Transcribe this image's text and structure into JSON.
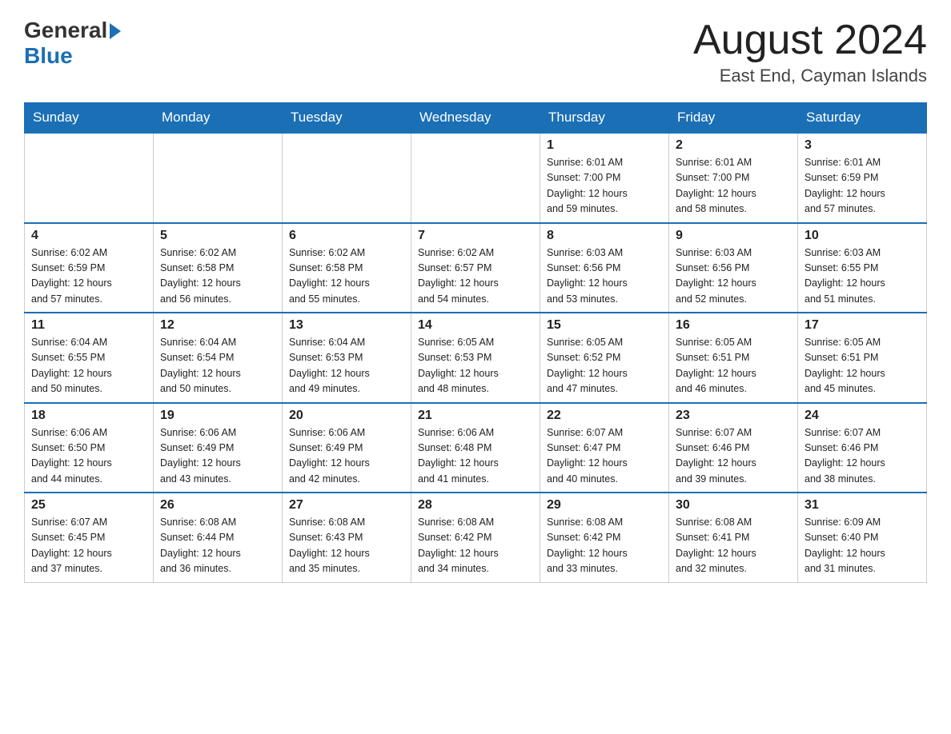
{
  "header": {
    "logo_general": "General",
    "logo_blue": "Blue",
    "month_title": "August 2024",
    "location": "East End, Cayman Islands"
  },
  "weekdays": [
    "Sunday",
    "Monday",
    "Tuesday",
    "Wednesday",
    "Thursday",
    "Friday",
    "Saturday"
  ],
  "weeks": [
    [
      {
        "day": "",
        "info": ""
      },
      {
        "day": "",
        "info": ""
      },
      {
        "day": "",
        "info": ""
      },
      {
        "day": "",
        "info": ""
      },
      {
        "day": "1",
        "info": "Sunrise: 6:01 AM\nSunset: 7:00 PM\nDaylight: 12 hours\nand 59 minutes."
      },
      {
        "day": "2",
        "info": "Sunrise: 6:01 AM\nSunset: 7:00 PM\nDaylight: 12 hours\nand 58 minutes."
      },
      {
        "day": "3",
        "info": "Sunrise: 6:01 AM\nSunset: 6:59 PM\nDaylight: 12 hours\nand 57 minutes."
      }
    ],
    [
      {
        "day": "4",
        "info": "Sunrise: 6:02 AM\nSunset: 6:59 PM\nDaylight: 12 hours\nand 57 minutes."
      },
      {
        "day": "5",
        "info": "Sunrise: 6:02 AM\nSunset: 6:58 PM\nDaylight: 12 hours\nand 56 minutes."
      },
      {
        "day": "6",
        "info": "Sunrise: 6:02 AM\nSunset: 6:58 PM\nDaylight: 12 hours\nand 55 minutes."
      },
      {
        "day": "7",
        "info": "Sunrise: 6:02 AM\nSunset: 6:57 PM\nDaylight: 12 hours\nand 54 minutes."
      },
      {
        "day": "8",
        "info": "Sunrise: 6:03 AM\nSunset: 6:56 PM\nDaylight: 12 hours\nand 53 minutes."
      },
      {
        "day": "9",
        "info": "Sunrise: 6:03 AM\nSunset: 6:56 PM\nDaylight: 12 hours\nand 52 minutes."
      },
      {
        "day": "10",
        "info": "Sunrise: 6:03 AM\nSunset: 6:55 PM\nDaylight: 12 hours\nand 51 minutes."
      }
    ],
    [
      {
        "day": "11",
        "info": "Sunrise: 6:04 AM\nSunset: 6:55 PM\nDaylight: 12 hours\nand 50 minutes."
      },
      {
        "day": "12",
        "info": "Sunrise: 6:04 AM\nSunset: 6:54 PM\nDaylight: 12 hours\nand 50 minutes."
      },
      {
        "day": "13",
        "info": "Sunrise: 6:04 AM\nSunset: 6:53 PM\nDaylight: 12 hours\nand 49 minutes."
      },
      {
        "day": "14",
        "info": "Sunrise: 6:05 AM\nSunset: 6:53 PM\nDaylight: 12 hours\nand 48 minutes."
      },
      {
        "day": "15",
        "info": "Sunrise: 6:05 AM\nSunset: 6:52 PM\nDaylight: 12 hours\nand 47 minutes."
      },
      {
        "day": "16",
        "info": "Sunrise: 6:05 AM\nSunset: 6:51 PM\nDaylight: 12 hours\nand 46 minutes."
      },
      {
        "day": "17",
        "info": "Sunrise: 6:05 AM\nSunset: 6:51 PM\nDaylight: 12 hours\nand 45 minutes."
      }
    ],
    [
      {
        "day": "18",
        "info": "Sunrise: 6:06 AM\nSunset: 6:50 PM\nDaylight: 12 hours\nand 44 minutes."
      },
      {
        "day": "19",
        "info": "Sunrise: 6:06 AM\nSunset: 6:49 PM\nDaylight: 12 hours\nand 43 minutes."
      },
      {
        "day": "20",
        "info": "Sunrise: 6:06 AM\nSunset: 6:49 PM\nDaylight: 12 hours\nand 42 minutes."
      },
      {
        "day": "21",
        "info": "Sunrise: 6:06 AM\nSunset: 6:48 PM\nDaylight: 12 hours\nand 41 minutes."
      },
      {
        "day": "22",
        "info": "Sunrise: 6:07 AM\nSunset: 6:47 PM\nDaylight: 12 hours\nand 40 minutes."
      },
      {
        "day": "23",
        "info": "Sunrise: 6:07 AM\nSunset: 6:46 PM\nDaylight: 12 hours\nand 39 minutes."
      },
      {
        "day": "24",
        "info": "Sunrise: 6:07 AM\nSunset: 6:46 PM\nDaylight: 12 hours\nand 38 minutes."
      }
    ],
    [
      {
        "day": "25",
        "info": "Sunrise: 6:07 AM\nSunset: 6:45 PM\nDaylight: 12 hours\nand 37 minutes."
      },
      {
        "day": "26",
        "info": "Sunrise: 6:08 AM\nSunset: 6:44 PM\nDaylight: 12 hours\nand 36 minutes."
      },
      {
        "day": "27",
        "info": "Sunrise: 6:08 AM\nSunset: 6:43 PM\nDaylight: 12 hours\nand 35 minutes."
      },
      {
        "day": "28",
        "info": "Sunrise: 6:08 AM\nSunset: 6:42 PM\nDaylight: 12 hours\nand 34 minutes."
      },
      {
        "day": "29",
        "info": "Sunrise: 6:08 AM\nSunset: 6:42 PM\nDaylight: 12 hours\nand 33 minutes."
      },
      {
        "day": "30",
        "info": "Sunrise: 6:08 AM\nSunset: 6:41 PM\nDaylight: 12 hours\nand 32 minutes."
      },
      {
        "day": "31",
        "info": "Sunrise: 6:09 AM\nSunset: 6:40 PM\nDaylight: 12 hours\nand 31 minutes."
      }
    ]
  ]
}
